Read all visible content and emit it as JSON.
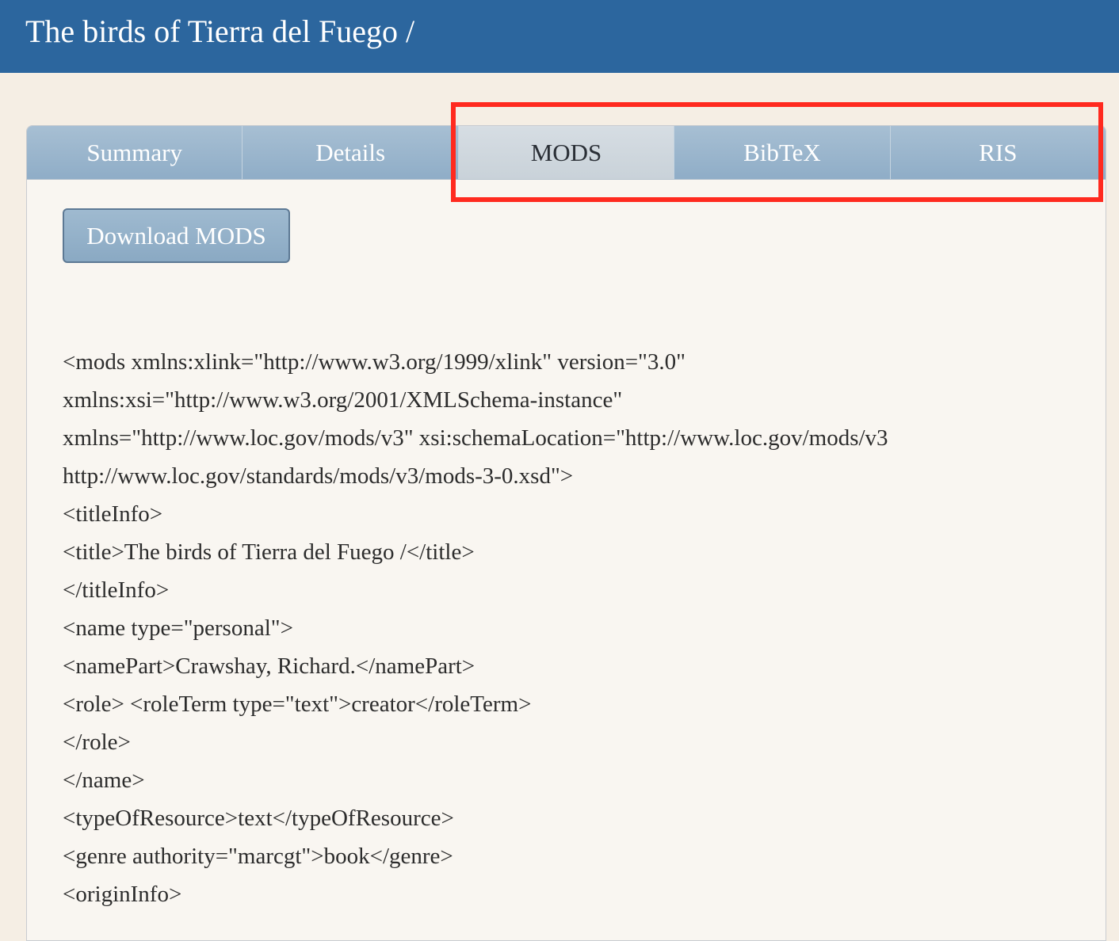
{
  "header": {
    "title": "The birds of Tierra del Fuego /"
  },
  "tabs": [
    {
      "label": "Summary",
      "active": false
    },
    {
      "label": "Details",
      "active": false
    },
    {
      "label": "MODS",
      "active": true
    },
    {
      "label": "BibTeX",
      "active": false
    },
    {
      "label": "RIS",
      "active": false
    }
  ],
  "download_button": {
    "label": "Download MODS"
  },
  "mods_lines": [
    "<mods xmlns:xlink=\"http://www.w3.org/1999/xlink\" version=\"3.0\"",
    "xmlns:xsi=\"http://www.w3.org/2001/XMLSchema-instance\"",
    "xmlns=\"http://www.loc.gov/mods/v3\" xsi:schemaLocation=\"http://www.loc.gov/mods/v3",
    "http://www.loc.gov/standards/mods/v3/mods-3-0.xsd\">",
    "<titleInfo>",
    "<title>The birds of Tierra del Fuego /</title>",
    "</titleInfo>",
    "<name type=\"personal\">",
    "<namePart>Crawshay, Richard.</namePart>",
    "<role> <roleTerm type=\"text\">creator</roleTerm>",
    "</role>",
    "</name>",
    "<typeOfResource>text</typeOfResource>",
    "<genre authority=\"marcgt\">book</genre>",
    "<originInfo>"
  ],
  "colors": {
    "header_bg": "#2c669e",
    "page_bg": "#f5eee4",
    "tab_bg": "#98b4cc",
    "tab_active_bg": "#cfd7de",
    "highlight": "#ff2a1f"
  }
}
